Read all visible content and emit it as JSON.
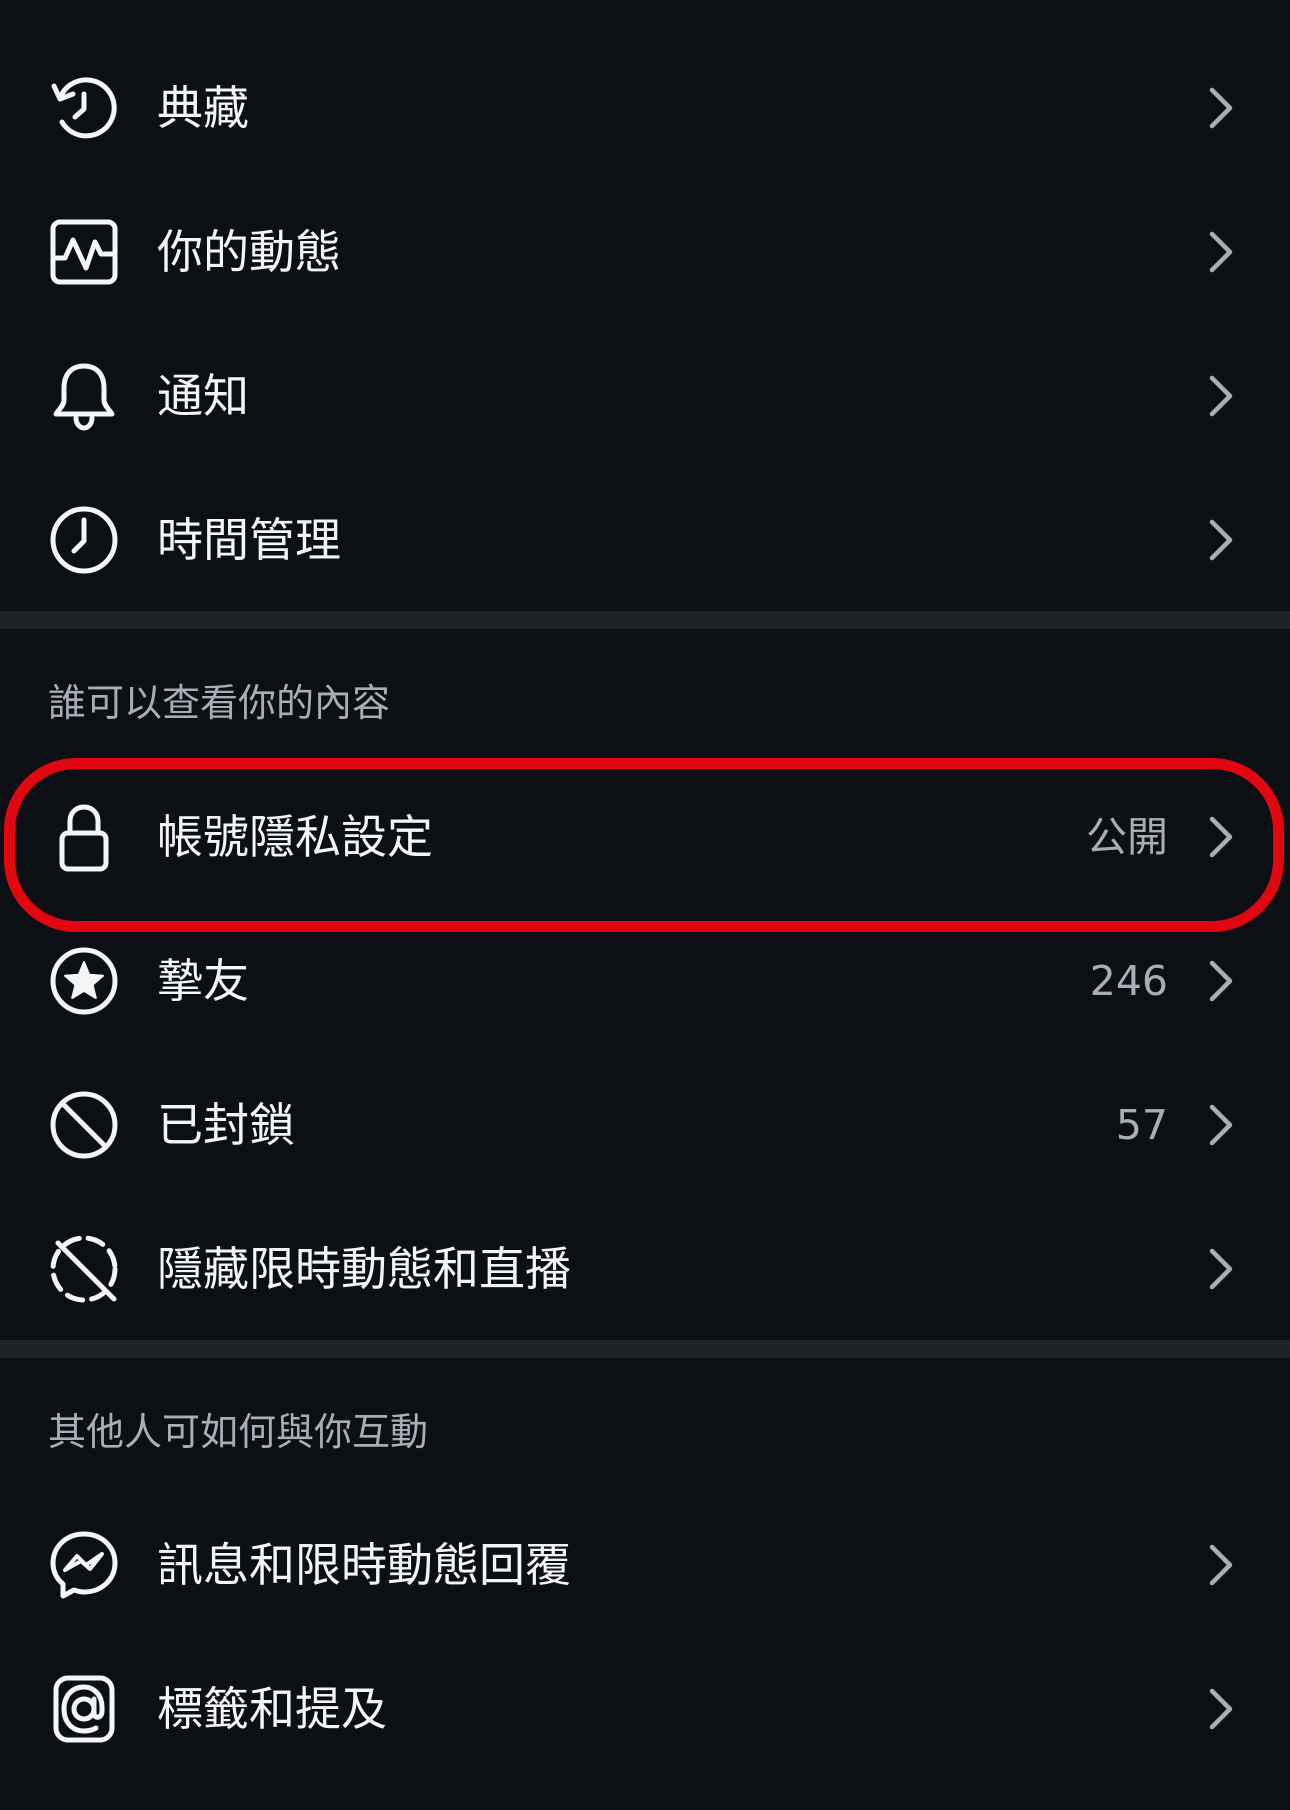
{
  "rows_top": [
    {
      "key": "archive",
      "label": "典藏",
      "icon": "archive-history-icon"
    },
    {
      "key": "your-activity",
      "label": "你的動態",
      "icon": "activity-icon"
    },
    {
      "key": "notifications",
      "label": "通知",
      "icon": "bell-icon"
    },
    {
      "key": "time-management",
      "label": "時間管理",
      "icon": "clock-icon"
    }
  ],
  "section_visibility": {
    "header": "誰可以查看你的內容",
    "rows": [
      {
        "key": "account-privacy",
        "label": "帳號隱私設定",
        "value": "公開",
        "icon": "lock-icon"
      },
      {
        "key": "close-friends",
        "label": "摯友",
        "value": "246",
        "icon": "star-icon"
      },
      {
        "key": "blocked",
        "label": "已封鎖",
        "value": "57",
        "icon": "blocked-icon"
      },
      {
        "key": "hide-story",
        "label": "隱藏限時動態和直播",
        "icon": "hide-story-icon"
      }
    ]
  },
  "section_interaction": {
    "header": "其他人可如何與你互動",
    "rows": [
      {
        "key": "messages",
        "label": "訊息和限時動態回覆",
        "icon": "messenger-icon"
      },
      {
        "key": "tags",
        "label": "標籤和提及",
        "icon": "at-sign-icon"
      }
    ]
  },
  "colors": {
    "background": "#0c0f14",
    "text": "#f4f5f7",
    "secondary_text": "#a9adb5",
    "divider": "#1f2227",
    "highlight": "#e1060f"
  }
}
